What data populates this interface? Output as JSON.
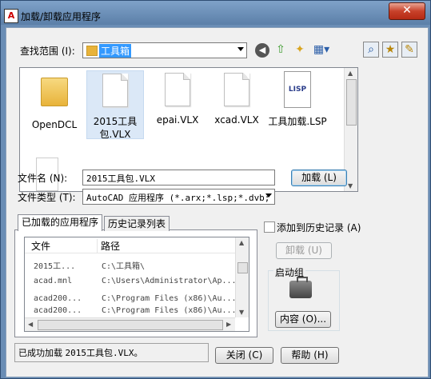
{
  "window": {
    "title": "加载/卸载应用程序",
    "app_icon": "A",
    "close_glyph": "✕"
  },
  "lookin": {
    "label": "查找范围 (I):",
    "value": "工具箱"
  },
  "files": [
    {
      "name": "OpenDCL",
      "icon": "folder-icon"
    },
    {
      "name": "2015工具包.VLX",
      "icon": "file-icon",
      "selected": true
    },
    {
      "name": "epai.VLX",
      "icon": "file-icon"
    },
    {
      "name": "xcad.VLX",
      "icon": "file-icon"
    },
    {
      "name": "工具加载.LSP",
      "icon": "lsp-file-icon",
      "icon_text": "LISP"
    }
  ],
  "filename": {
    "label": "文件名 (N):",
    "value": "2015工具包.VLX"
  },
  "filetype": {
    "label": "文件类型 (T):",
    "value": "AutoCAD 应用程序 (*.arx;*.lsp;*.dvb;"
  },
  "load_button": "加载 (L)",
  "tabs": [
    "已加载的应用程序",
    "历史记录列表"
  ],
  "add_history": "添加到历史记录 (A)",
  "unload_button": "卸载 (U)",
  "startup_group": {
    "label": "启动组",
    "button": "内容 (O)..."
  },
  "list": {
    "headers": [
      "文件",
      "路径"
    ],
    "rows": [
      {
        "file": "2015工...",
        "path": "C:\\工具箱\\"
      },
      {
        "file": "acad.mnl",
        "path": "C:\\Users\\Administrator\\Ap..."
      },
      {
        "file": "acad200...",
        "path": "C:\\Program Files (x86)\\Au..."
      },
      {
        "file": "acad200...",
        "path": "C:\\Program Files (x86)\\Au..."
      }
    ]
  },
  "status": {
    "prefix": "已成功加载 ",
    "value": "2015工具包.VLX。"
  },
  "close_button": "关闭 (C)",
  "help_button": "帮助 (H)"
}
